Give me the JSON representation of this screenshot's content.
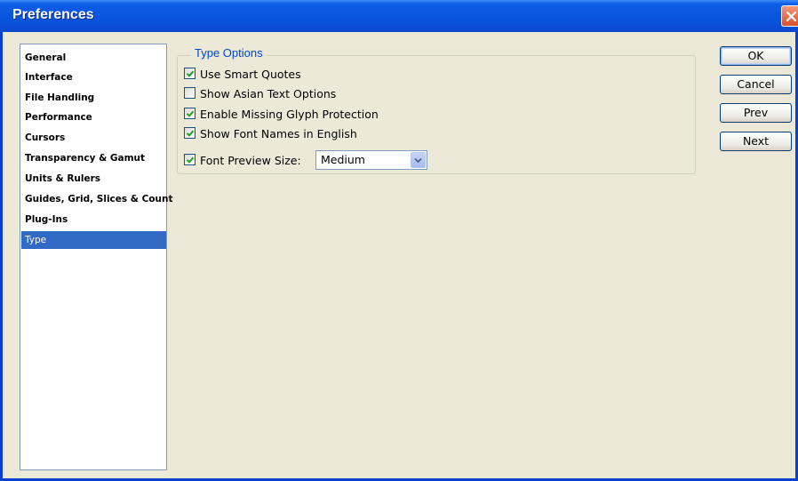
{
  "window": {
    "title": "Preferences"
  },
  "sidebar": {
    "items": [
      {
        "label": "General"
      },
      {
        "label": "Interface"
      },
      {
        "label": "File Handling"
      },
      {
        "label": "Performance"
      },
      {
        "label": "Cursors"
      },
      {
        "label": "Transparency & Gamut"
      },
      {
        "label": "Units & Rulers"
      },
      {
        "label": "Guides, Grid, Slices & Count"
      },
      {
        "label": "Plug-Ins"
      },
      {
        "label": "Type",
        "selected": true
      }
    ]
  },
  "type_options": {
    "legend": "Type Options",
    "use_smart_quotes": {
      "label": "Use Smart Quotes",
      "checked": true
    },
    "show_asian_text": {
      "label": "Show Asian Text Options",
      "checked": false
    },
    "missing_glyph": {
      "label": "Enable Missing Glyph Protection",
      "checked": true
    },
    "font_names_english": {
      "label": "Show Font Names in English",
      "checked": true
    },
    "font_preview": {
      "label": "Font Preview Size:",
      "checked": true,
      "value": "Medium"
    }
  },
  "buttons": {
    "ok": "OK",
    "cancel": "Cancel",
    "prev": "Prev",
    "next": "Next"
  },
  "colors": {
    "titlebar": "#0a55de",
    "selection": "#316ac5",
    "group_legend": "#0046d5",
    "dialog_background": "#ece9d8",
    "checkmark": "#21a121"
  },
  "icons": {
    "close": "close-icon",
    "checkmark": "checkmark-icon",
    "dropdown": "chevron-down-icon"
  }
}
